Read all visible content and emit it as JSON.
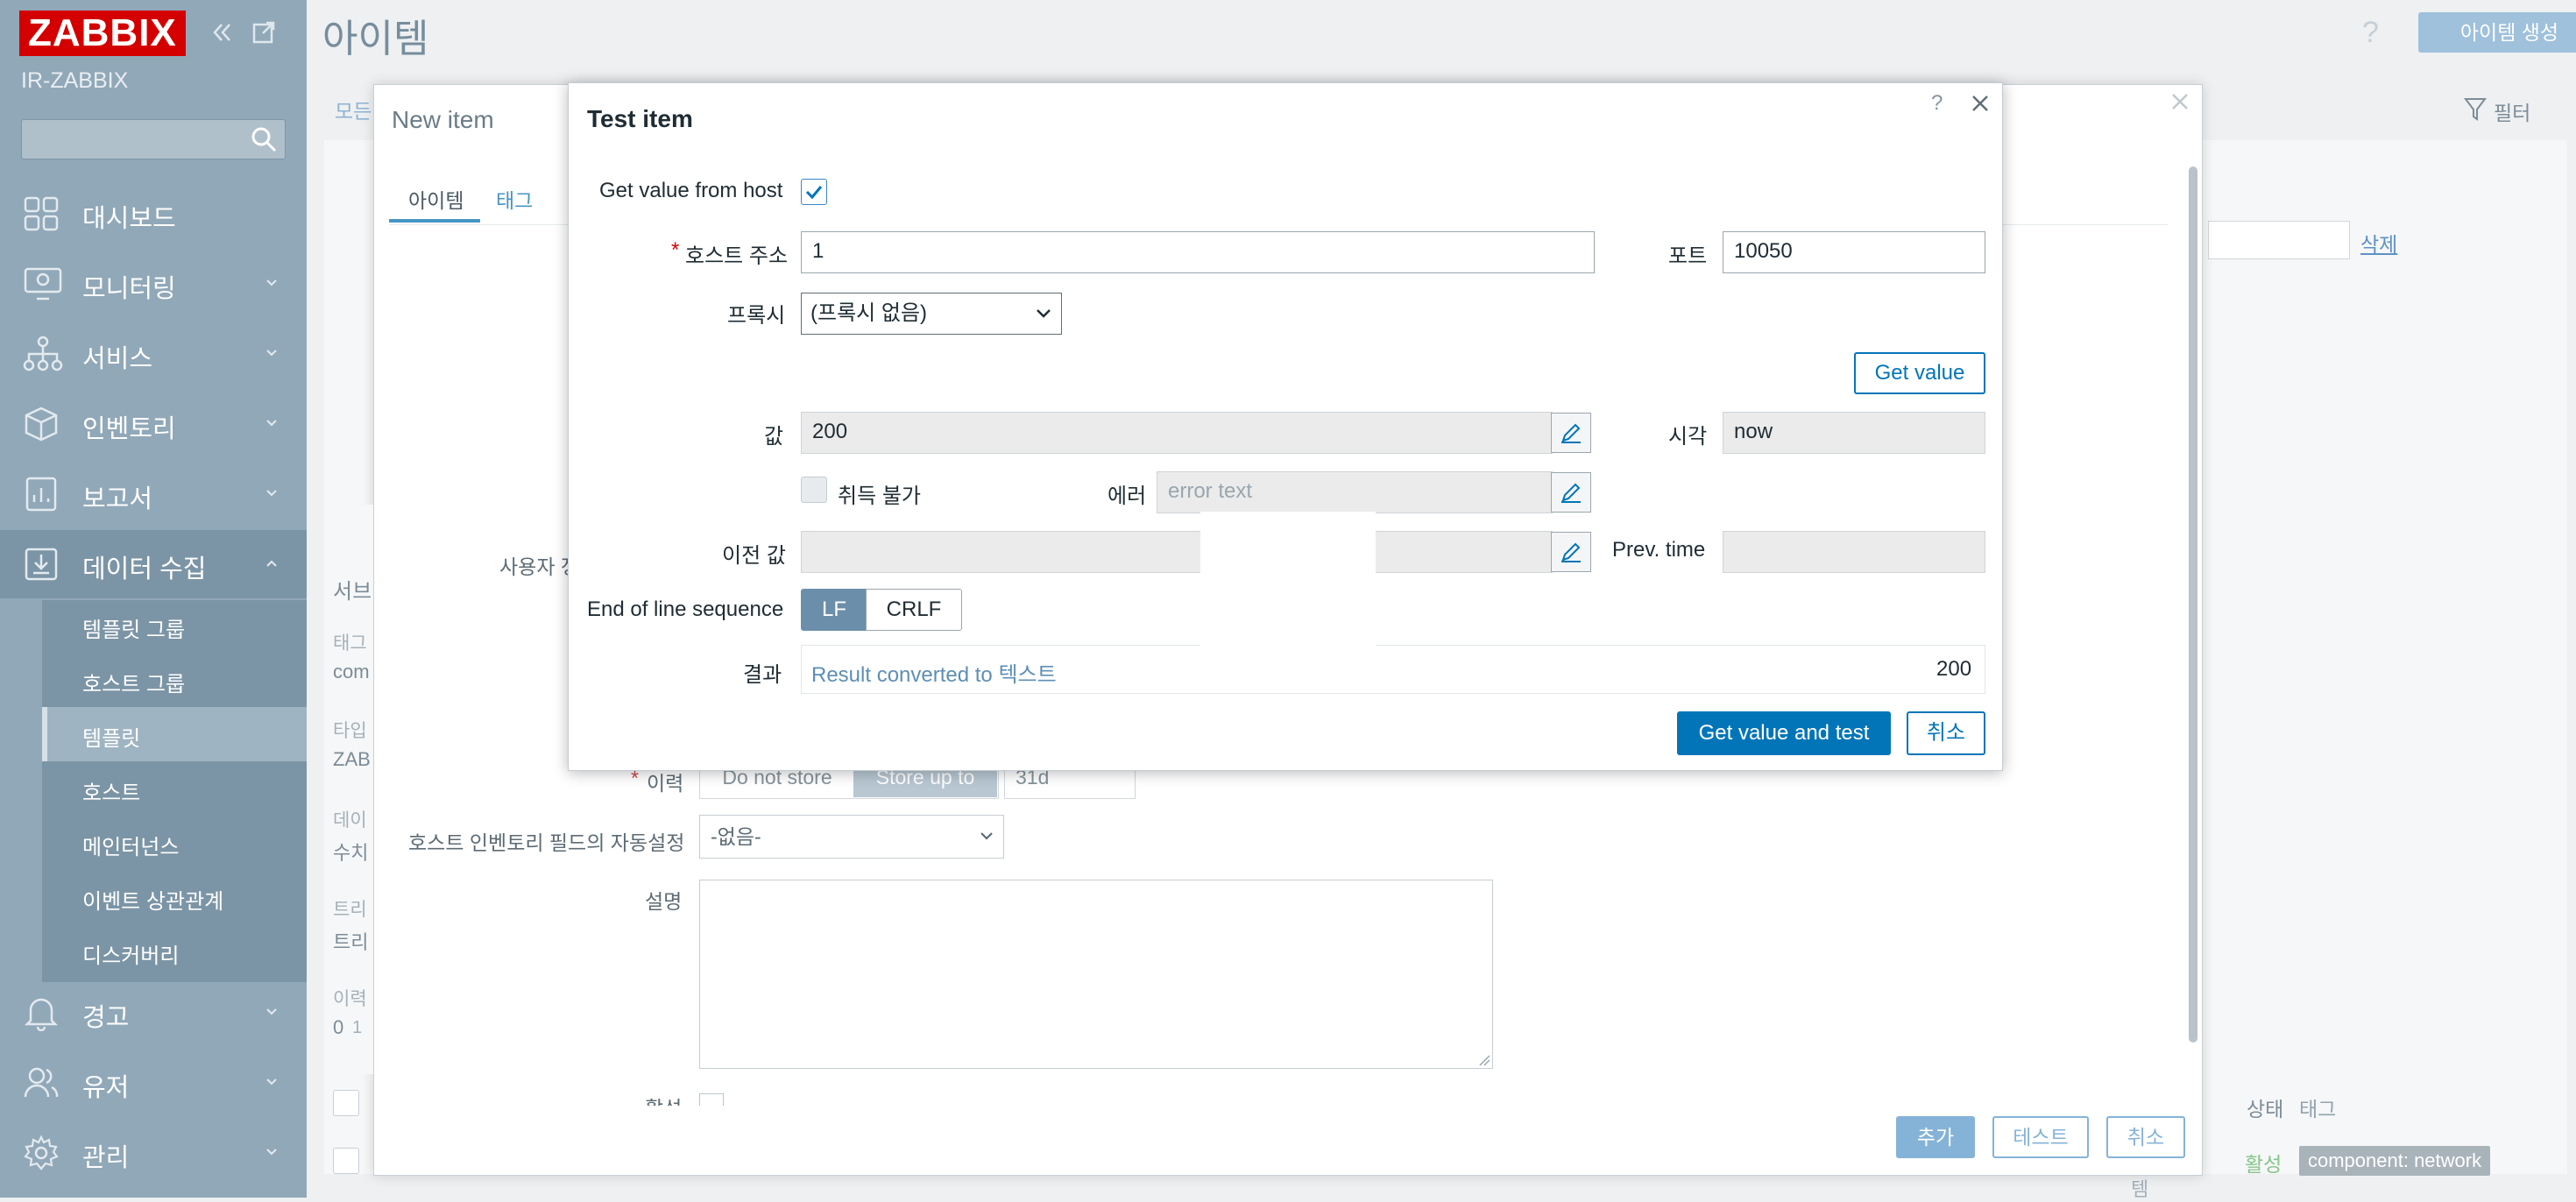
{
  "sidebar": {
    "logo": "ZABBIX",
    "server_name": "IR-ZABBIX",
    "nav": [
      {
        "label": "대시보드",
        "icon": "dashboard-icon"
      },
      {
        "label": "모니터링",
        "icon": "monitoring-icon"
      },
      {
        "label": "서비스",
        "icon": "services-icon"
      },
      {
        "label": "인벤토리",
        "icon": "inventory-icon"
      },
      {
        "label": "보고서",
        "icon": "reports-icon"
      },
      {
        "label": "데이터 수집",
        "icon": "data-collection-icon"
      },
      {
        "label": "경고",
        "icon": "alerts-icon"
      },
      {
        "label": "유저",
        "icon": "users-icon"
      },
      {
        "label": "관리",
        "icon": "administration-icon"
      }
    ],
    "submenu": [
      "템플릿 그룹",
      "호스트 그룹",
      "템플릿",
      "호스트",
      "메인터넌스",
      "이벤트 상관관계",
      "디스커버리"
    ]
  },
  "main": {
    "title": "아이템",
    "help": "?",
    "create_button": "아이템 생성",
    "filter_label": "필터",
    "breadcrumb_start": "모든",
    "delete_link": "삭제",
    "table": {
      "status_header": "상태",
      "tag_header": "태그",
      "status_value": "활성",
      "tag_value": "component: network",
      "row_suffix": "템"
    },
    "left_labels": {
      "server": "서브",
      "tag": "태그",
      "tag_value": "com",
      "type": "타입",
      "type_value": "ZAB",
      "data": "데이",
      "data_value": "수치",
      "trigger": "트리",
      "trigger_value": "트리",
      "history": "이력",
      "history_value": "0",
      "history_value2": "1"
    }
  },
  "new_item": {
    "title": "New item",
    "help": "?",
    "tabs": [
      "아이템",
      "태그"
    ],
    "user_label": "사용자 정",
    "history_label": "이력",
    "history_options": [
      "Do not store",
      "Store up to"
    ],
    "history_value": "31d",
    "inventory_label": "호스트 인벤토리 필드의 자동설정",
    "inventory_value": "-없음-",
    "description_label": "설명",
    "enabled_label": "활성",
    "buttons": {
      "add": "추가",
      "test": "테스트",
      "cancel": "취소"
    }
  },
  "test_item": {
    "title": "Test item",
    "help": "?",
    "get_value_from_host_label": "Get value from host",
    "host_address_label": "호스트 주소",
    "host_address_value": "1",
    "port_label": "포트",
    "port_value": "10050",
    "proxy_label": "프록시",
    "proxy_value": "(프록시 없음)",
    "get_value_button": "Get value",
    "value_label": "값",
    "value": "200",
    "time_label": "시각",
    "time_value": "now",
    "not_supported_label": "취득 불가",
    "error_label": "에러",
    "error_placeholder": "error text",
    "prev_value_label": "이전 값",
    "prev_time_label": "Prev. time",
    "eol_label": "End of line sequence",
    "eol_options": [
      "LF",
      "CRLF"
    ],
    "result_label": "결과",
    "result_text": "Result converted to 텍스트",
    "result_value": "200",
    "buttons": {
      "get_value_and_test": "Get value and test",
      "cancel": "취소"
    }
  }
}
